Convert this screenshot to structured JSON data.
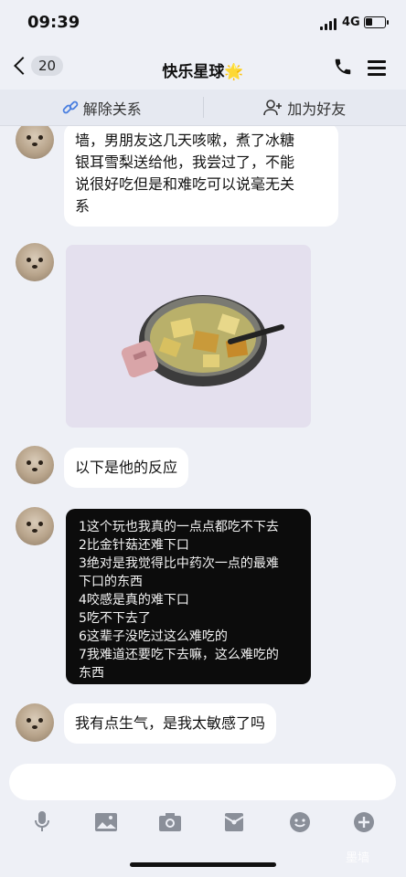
{
  "status_bar": {
    "time": "09:39",
    "network": "4G"
  },
  "header": {
    "unread_count": "20",
    "title": "快乐星球",
    "title_emoji": "🌟"
  },
  "relation_bar": {
    "unbind_label": "解除关系",
    "add_friend_label": "加为好友"
  },
  "messages": [
    {
      "type": "text",
      "lines": [
        "墙，男朋友这几天咳嗽，煮了冰糖",
        "银耳雪梨送给他，我尝过了，不能",
        "说很好吃但是和难吃可以说毫无关",
        "系"
      ]
    },
    {
      "type": "image",
      "description": "pot of soup"
    },
    {
      "type": "text",
      "lines": [
        "以下是他的反应"
      ]
    },
    {
      "type": "dark_text",
      "lines": [
        "1这个玩也我真的一点点都吃不下去",
        "2比金针菇还难下口",
        "3绝对是我觉得比中药次一点的最难",
        "下口的东西",
        "4咬感是真的难下口",
        "5吃不下去了",
        "6这辈子没吃过这么难吃的",
        "7我难道还要吃下去嘛，这么难吃的",
        "东西"
      ]
    },
    {
      "type": "text",
      "lines": [
        "我有点生气，是我太敏感了吗"
      ]
    }
  ],
  "toolbar": {
    "icons": [
      "microphone-icon",
      "image-icon",
      "camera-icon",
      "red-packet-icon",
      "emoji-icon",
      "plus-icon"
    ]
  },
  "watermark": "墨墙",
  "colors": {
    "background": "#eef0f6",
    "bubble": "#ffffff",
    "dark_bubble": "#0c0c0c"
  }
}
